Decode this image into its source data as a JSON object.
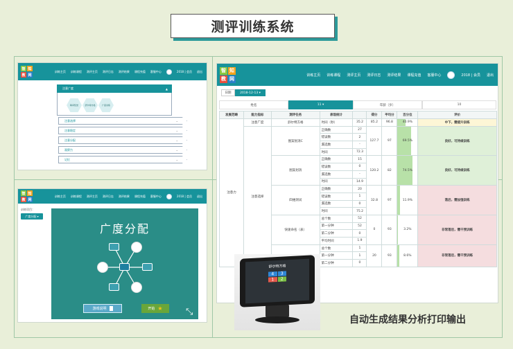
{
  "title": "测评训练系统",
  "caption": "自动生成结果分析打印输出",
  "nav": {
    "logo": [
      "智",
      "知",
      "教",
      "网"
    ],
    "items": [
      "训练主页",
      "训练课程",
      "测评主页",
      "测评日志",
      "测评结果",
      "课程充值",
      "客服中心"
    ],
    "year": "2018 | 会员",
    "logout": "退出"
  },
  "panel1": {
    "open_section": "注意广度",
    "open_chev": "▲",
    "hexes": [
      "瞬间知觉",
      "舒尔特方格",
      "广度训练"
    ],
    "sections": [
      "注意选择",
      "注意稳定",
      "注意分配",
      "观察力",
      "记忆"
    ],
    "chev": "⌄"
  },
  "panel2": {
    "side_label": "训练项目：",
    "select": "广度分配 ▾",
    "game_title": "广度分配",
    "btn_rules": "游戏说明",
    "btn_start": "开始",
    "expand_icon": "⤡"
  },
  "panel3": {
    "date_tab": "日期",
    "date_value": "2018-12-13 ▾",
    "info": [
      "姓名",
      "11 ▾",
      "年龄（岁）",
      "10"
    ],
    "headers": [
      "发展范畴",
      "能力指标",
      "测评任务",
      "表现统计",
      "",
      "得分",
      "平均分",
      "百分位",
      "评价"
    ],
    "rows": [
      {
        "cat": "注意力",
        "ability": "注意广度",
        "task": "舒尔特方格",
        "stat": "时间（秒）",
        "val": "35.2",
        "score": "85.2",
        "avg": "96.8",
        "pct": "40.9%",
        "pctv": 40.9,
        "eval": "中下，需提升训练",
        "evc": "evmid"
      },
      {
        "ability": "注意选择",
        "task": "图案划消C",
        "stats": [
          [
            "正确数",
            "27"
          ],
          [
            "错误数",
            "2"
          ],
          [
            "漏选数",
            "-"
          ],
          [
            "时间",
            "72.3"
          ]
        ],
        "score": "127.7",
        "avg": "97",
        "pct": "69.5%",
        "pctv": 69.5,
        "eval": "良好，可持续训练",
        "evc": "evgood"
      },
      {
        "task": "图案划消",
        "stats": [
          [
            "正确数",
            "15"
          ],
          [
            "错误数",
            "0"
          ],
          [
            "漏选数",
            "-"
          ],
          [
            "时间",
            "14.9"
          ]
        ],
        "score": "120.2",
        "avg": "82",
        "pct": "74.5%",
        "pctv": 74.5,
        "eval": "良好，可持续训练",
        "evc": "evgood"
      },
      {
        "task": "四维测试",
        "stats": [
          [
            "正确数",
            "20"
          ],
          [
            "错误数",
            "1"
          ],
          [
            "漏选数",
            "0"
          ],
          [
            "时间",
            "75.2"
          ]
        ],
        "score": "32.8",
        "avg": "97",
        "pct": "11.9%",
        "pctv": 11.9,
        "eval": "落后，需加强训练",
        "evc": "evbad"
      },
      {
        "task": "快速命名（表）",
        "stats": [
          [
            "总个数",
            "52"
          ],
          [
            "第一分钟",
            "52"
          ],
          [
            "第二分钟",
            "0"
          ],
          [
            "平均时间",
            "1.9"
          ]
        ],
        "score": "0",
        "avg": "93",
        "pct": "3.2%",
        "pctv": 3.2,
        "eval": "非常落后，需干预训练",
        "evc": "evbad"
      },
      {
        "stats": [
          [
            "总个数",
            "1"
          ],
          [
            "第一分钟",
            "1"
          ],
          [
            "第二分钟",
            "0"
          ]
        ],
        "score": "20",
        "avg": "93",
        "pct": "8.6%",
        "pctv": 8.6,
        "eval": "非常落后，需干预训练",
        "evc": "evbad"
      }
    ],
    "tablet_title": "舒尔特方格",
    "tablet_nums": [
      "4",
      "3",
      "1",
      "2"
    ]
  }
}
